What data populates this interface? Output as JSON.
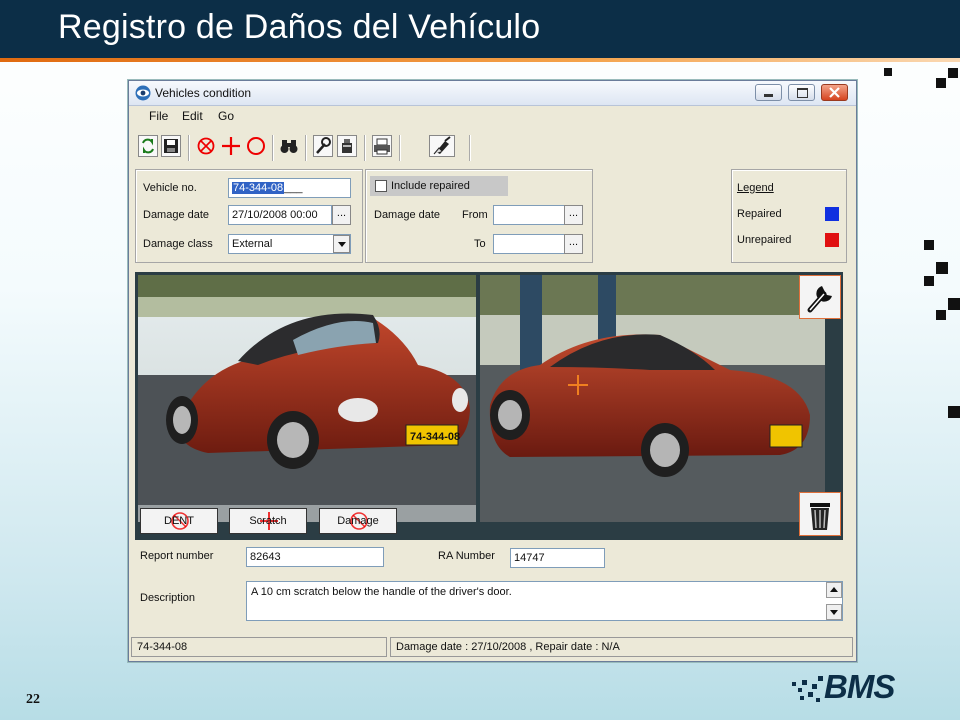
{
  "slide": {
    "title": "Registro de Daños del Vehículo",
    "number": "22",
    "logo_text": "BMS"
  },
  "window": {
    "title": "Vehicles condition",
    "icon": "eye-icon",
    "controls": [
      "minimize-icon",
      "maximize-icon",
      "close-icon"
    ]
  },
  "menu": {
    "items": [
      "File",
      "Edit",
      "Go"
    ]
  },
  "toolbar": {
    "icons": [
      "refresh-icon",
      "save-icon",
      "dent-marker-icon",
      "scratch-marker-icon",
      "damage-marker-icon",
      "binoculars-icon",
      "repair-tools-icon",
      "cleaning-icon",
      "print-icon",
      "brush-icon"
    ]
  },
  "filters": {
    "vehicle_no_label": "Vehicle no.",
    "vehicle_no_value": "74-344-08",
    "damage_date_label": "Damage date",
    "damage_date_value": "27/10/2008 00:00",
    "damage_class_label": "Damage class",
    "damage_class_value": "External",
    "include_repaired_label": "Include repaired",
    "range_damage_date_label": "Damage date",
    "from_label": "From",
    "to_label": "To",
    "dots": "..."
  },
  "legend": {
    "title": "Legend",
    "repaired_label": "Repaired",
    "repaired_color": "#1030e0",
    "unrepaired_label": "Unrepaired",
    "unrepaired_color": "#e01010"
  },
  "photos": {
    "plate_text": "74-344-08"
  },
  "damage_buttons": [
    "DENT",
    "Scratch",
    "Damage"
  ],
  "side_tools": [
    "wrench-icon",
    "trash-icon"
  ],
  "report": {
    "report_number_label": "Report number",
    "report_number_value": "82643",
    "ra_number_label": "RA Number",
    "ra_number_value": "14747",
    "description_label": "Description",
    "description_value": "A  10 cm scratch below the handle of  the driver's door."
  },
  "status": {
    "vehicle": "74-344-08",
    "dates": "Damage date : 27/10/2008 , Repair date : N/A"
  }
}
